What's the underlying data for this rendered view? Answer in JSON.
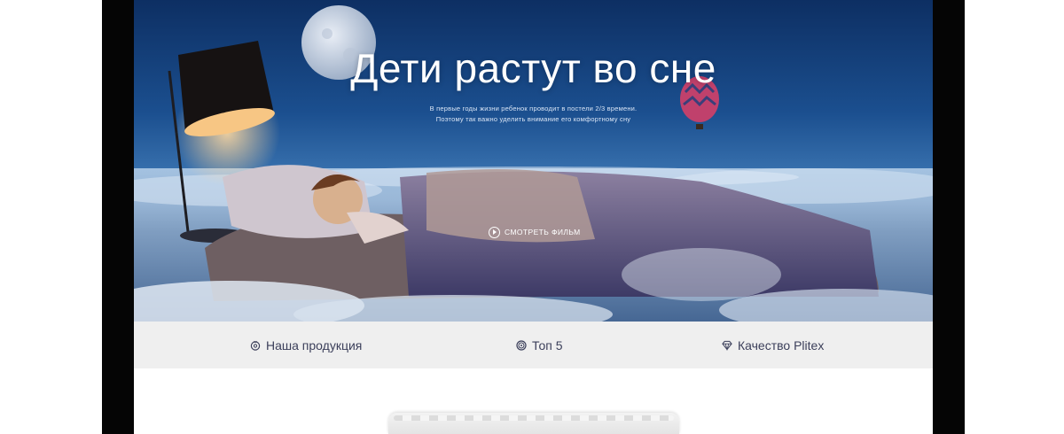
{
  "hero": {
    "title": "Дети растут во сне",
    "subtitle_line1": "В первые годы жизни ребенок проводит в постели 2/3 времени.",
    "subtitle_line2": "Поэтому так важно уделить внимание его комфортному сну",
    "watch_film_label": "СМОТРЕТЬ ФИЛЬМ"
  },
  "nav": {
    "items": [
      {
        "label": "Наша продукция",
        "icon": "product-icon"
      },
      {
        "label": "Топ 5",
        "icon": "top5-icon"
      },
      {
        "label": "Качество Plitex",
        "icon": "diamond-icon"
      }
    ]
  },
  "colors": {
    "nav_text": "#3b3f5a",
    "nav_bg": "#efefef",
    "bezel": "#050505"
  }
}
